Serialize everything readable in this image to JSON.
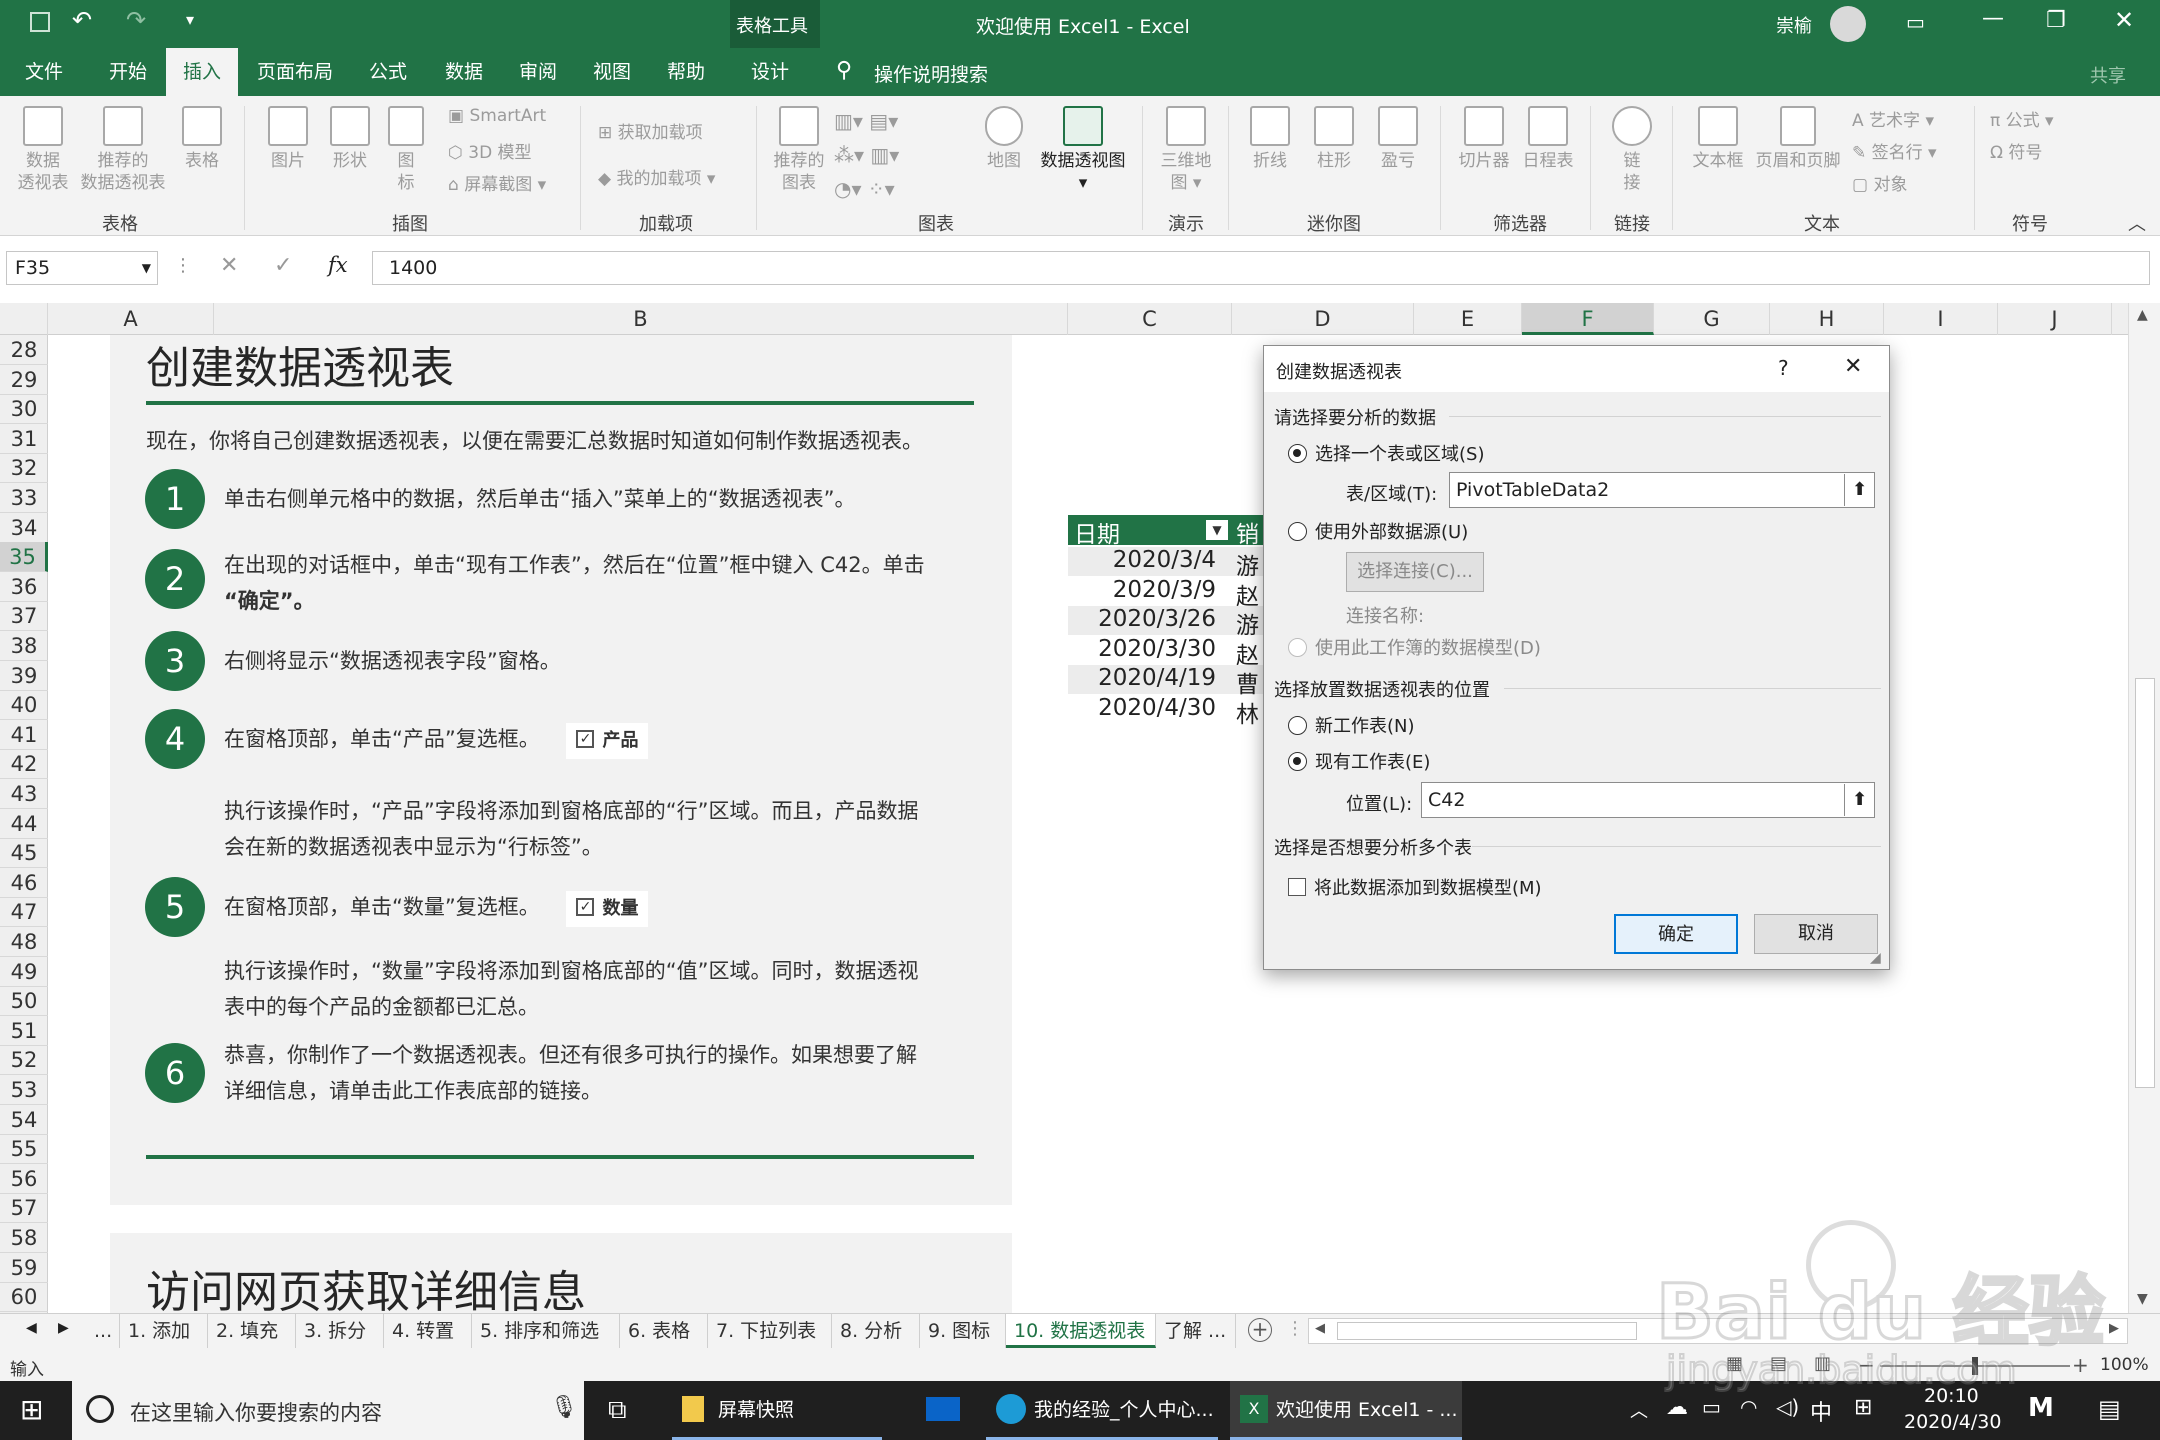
{
  "window": {
    "title": "欢迎使用 Excel1  -  Excel",
    "context_tab": "表格工具",
    "user": "崇榆"
  },
  "tabs": [
    "文件",
    "开始",
    "插入",
    "页面布局",
    "公式",
    "数据",
    "审阅",
    "视图",
    "帮助",
    "设计"
  ],
  "tell_me": "操作说明搜索",
  "share": "共享",
  "ribbon": {
    "b1": "数据",
    "b1b": "透视表",
    "b2": "推荐的",
    "b2b": "数据透视表",
    "b3": "表格",
    "b4": "图片",
    "b5": "形状",
    "b6": "图",
    "b6b": "标",
    "smartart": "SmartArt",
    "model3d": "3D 模型",
    "screenshot": "屏幕截图",
    "getaddins": "获取加载项",
    "myaddins": "我的加载项",
    "rec_chart": "推荐的",
    "rec_chart_b": "图表",
    "map": "地图",
    "pivotchart": "数据透视图",
    "map3d": "三维地",
    "map3d_b": "图",
    "line": "折线",
    "column": "柱形",
    "winloss": "盈亏",
    "slicer": "切片器",
    "timeline": "日程表",
    "link": "链",
    "link_b": "接",
    "textbox": "文本框",
    "headerfooter": "页眉和页脚",
    "wordart": "艺术字",
    "sigline": "签名行",
    "object": "对象",
    "equation": "公式",
    "symbol": "符号",
    "groups": {
      "table": "表格",
      "illus": "插图",
      "addins": "加载项",
      "charts": "图表",
      "tours": "演示",
      "spark": "迷你图",
      "filters": "筛选器",
      "links": "链接",
      "text": "文本",
      "symbols": "符号"
    }
  },
  "formula": {
    "namebox": "F35",
    "value": "1400",
    "fx": "fx"
  },
  "columns": [
    "A",
    "B",
    "C",
    "D",
    "E",
    "F",
    "G",
    "H",
    "I",
    "J"
  ],
  "rows": [
    "28",
    "29",
    "30",
    "31",
    "32",
    "33",
    "34",
    "35",
    "36",
    "37",
    "38",
    "39",
    "40",
    "41",
    "42",
    "43",
    "44",
    "45",
    "46",
    "47",
    "48",
    "49",
    "50",
    "51",
    "52",
    "53",
    "54",
    "55",
    "56",
    "57",
    "58",
    "59",
    "60"
  ],
  "content": {
    "heading": "创建数据透视表",
    "intro": "现在，你将自己创建数据透视表，以便在需要汇总数据时知道如何制作数据透视表。",
    "steps": [
      {
        "n": "1",
        "t": "单击右侧单元格中的数据，然后单击“插入”菜单上的“数据透视表”。"
      },
      {
        "n": "2",
        "t": "在出现的对话框中，单击“现有工作表”，然后在“位置”框中键入 C42。单击",
        "t2": "“确定”。"
      },
      {
        "n": "3",
        "t": "右侧将显示“数据透视表字段”窗格。"
      },
      {
        "n": "4",
        "t": "在窗格顶部，单击“产品”复选框。",
        "chk": "产品"
      },
      {
        "n": "5",
        "t": "在窗格顶部，单击“数量”复选框。",
        "chk": "数量"
      },
      {
        "n": "6",
        "t": "恭喜，你制作了一个数据透视表。但还有很多可执行的操作。如果想要了解",
        "t2": "详细信息，请单击此工作表底部的链接。"
      }
    ],
    "note4a": "执行该操作时，“产品”字段将添加到窗格底部的“行”区域。而且，产品数据",
    "note4b": "会在新的数据透视表中显示为“行标签”。",
    "note5a": "执行该操作时，“数量”字段将添加到窗格底部的“值”区域。同时，数据透视",
    "note5b": "表中的每个产品的金额都已汇总。",
    "heading2": "访问网页获取详细信息"
  },
  "table": {
    "h1": "日期",
    "h2": "销",
    "dates": [
      "2020/3/4",
      "2020/3/9",
      "2020/3/26",
      "2020/3/30",
      "2020/4/19",
      "2020/4/30"
    ],
    "names": [
      "游",
      "赵",
      "游",
      "赵",
      "曹",
      "林"
    ]
  },
  "dialog": {
    "title": "创建数据透视表",
    "help": "?",
    "close": "✕",
    "sec1": "请选择要分析的数据",
    "opt1": "选择一个表或区域(S)",
    "range_label": "表/区域(T):",
    "range_value": "PivotTableData2",
    "opt2": "使用外部数据源(U)",
    "choose_conn": "选择连接(C)...",
    "conn_name": "连接名称:",
    "opt3": "使用此工作簿的数据模型(D)",
    "sec2": "选择放置数据透视表的位置",
    "opt4": "新工作表(N)",
    "opt5": "现有工作表(E)",
    "loc_label": "位置(L):",
    "loc_value": "C42",
    "sec3": "选择是否想要分析多个表",
    "addmodel": "将此数据添加到数据模型(M)",
    "ok": "确定",
    "cancel": "取消"
  },
  "sheets": [
    "...",
    "1. 添加",
    "2. 填充",
    "3. 拆分",
    "4. 转置",
    "5. 排序和筛选",
    "6. 表格",
    "7. 下拉列表",
    "8. 分析",
    "9. 图标",
    "10. 数据透视表",
    "了解 ..."
  ],
  "status": {
    "mode": "输入",
    "zoom": "100%"
  },
  "taskbar": {
    "search": "在这里输入你要搜索的内容",
    "app1": "屏幕快照",
    "app2": "我的经验_个人中心...",
    "app3": "欢迎使用 Excel1 - ...",
    "time": "20:10",
    "date": "2020/4/30",
    "ime": "中"
  },
  "watermark": "Bai du 经验",
  "watermark2": "jingyan.baidu.com",
  "colors": {
    "green": "#217346"
  }
}
